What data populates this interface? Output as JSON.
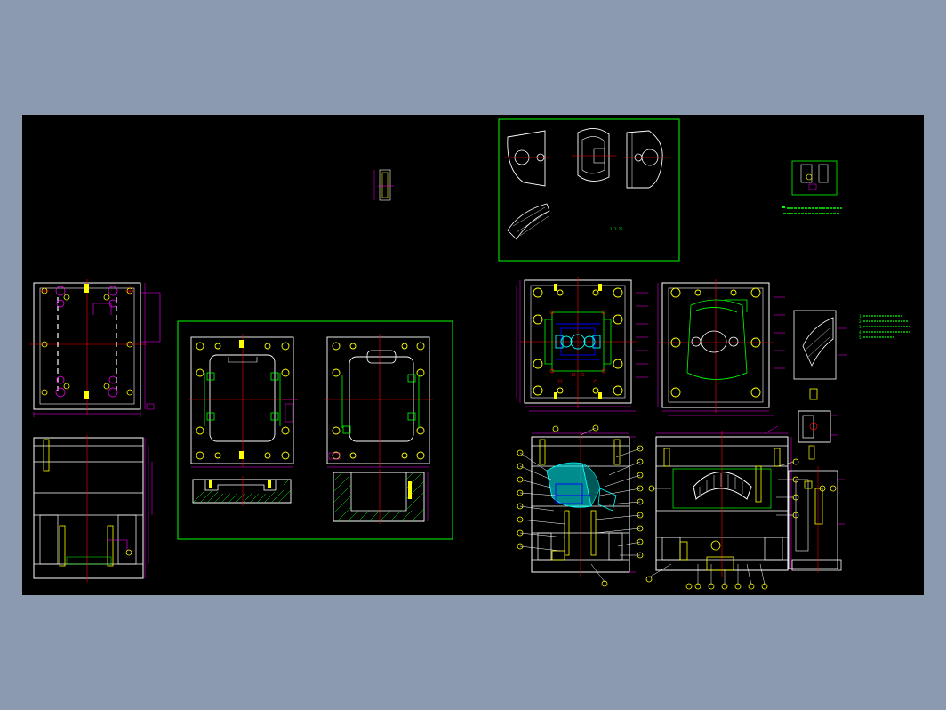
{
  "window": {
    "background_color": "#8b9aae"
  },
  "canvas": {
    "background_color": "#000000",
    "line_colors": {
      "frame": "#00ff00",
      "outline": "#ffffff",
      "dimension": "#ff00ff",
      "center": "#ff0000",
      "hole": "#ffff00",
      "part": "#00ffff",
      "hatch": "#00ff00",
      "component": "#0000ff"
    }
  },
  "drawing": {
    "product_scale_label": "1:1.25",
    "notes_1": [
      "1.",
      "2.",
      "3.",
      "4.",
      "5."
    ]
  },
  "views": [
    {
      "name": "top-left-plan-view"
    },
    {
      "name": "left-section-view"
    },
    {
      "name": "plate-views-panel"
    },
    {
      "name": "product-views-panel"
    },
    {
      "name": "mold-assembly-top-view"
    },
    {
      "name": "mold-assembly-top-view-b"
    },
    {
      "name": "mold-assembly-section-a"
    },
    {
      "name": "mold-assembly-section-b"
    },
    {
      "name": "detail-view-part"
    },
    {
      "name": "detail-view-mech"
    }
  ]
}
